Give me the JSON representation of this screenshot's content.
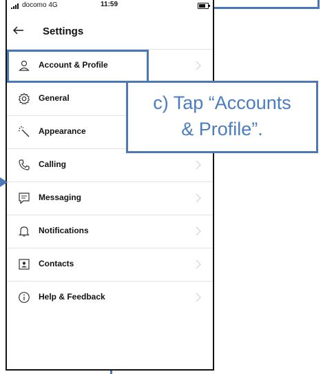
{
  "status_bar": {
    "carrier": "docomo 4G",
    "time": "11:59",
    "battery_level": 0.75
  },
  "header": {
    "back_icon": "back-arrow-icon",
    "title": "Settings"
  },
  "menu": [
    {
      "label": "Account & Profile",
      "icon": "person-icon"
    },
    {
      "label": "General",
      "icon": "gear-icon"
    },
    {
      "label": "Appearance",
      "icon": "magic-wand-icon"
    },
    {
      "label": "Calling",
      "icon": "phone-icon"
    },
    {
      "label": "Messaging",
      "icon": "message-icon"
    },
    {
      "label": "Notifications",
      "icon": "bell-icon"
    },
    {
      "label": "Contacts",
      "icon": "contact-card-icon"
    },
    {
      "label": "Help & Feedback",
      "icon": "info-icon"
    }
  ],
  "annotation": {
    "line1": "c) Tap “Accounts",
    "line2": "& Profile”."
  },
  "colors": {
    "annotation": "#4a7cc1",
    "annotation_border": "#4a77b8",
    "divider": "#e2e2e2"
  }
}
